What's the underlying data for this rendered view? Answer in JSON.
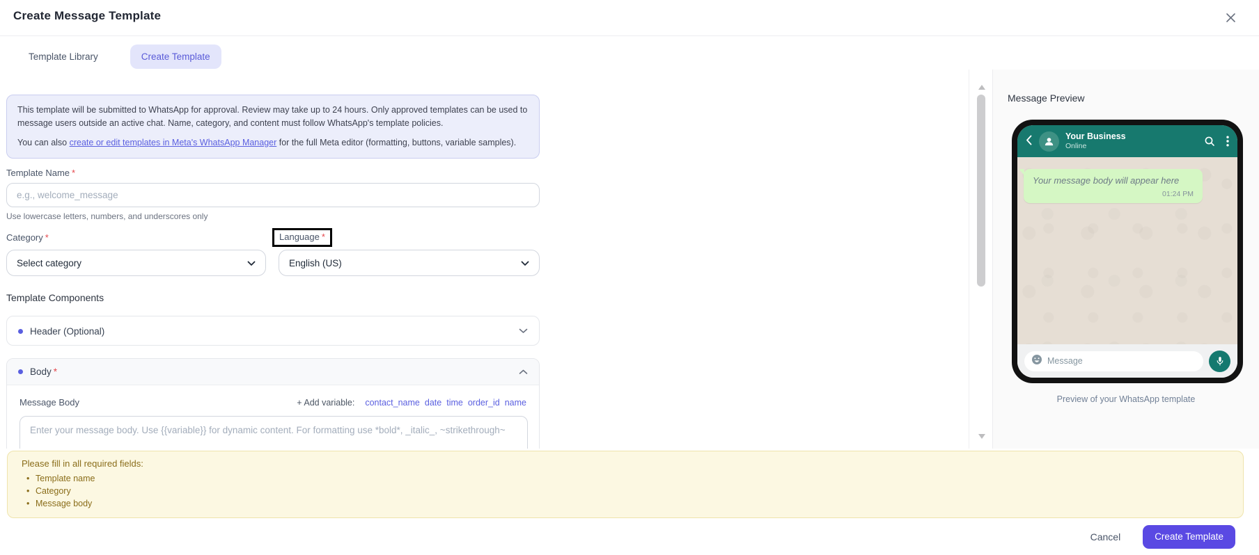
{
  "dialog": {
    "title": "Create Message Template"
  },
  "tabs": [
    {
      "label": "Template Library",
      "active": false
    },
    {
      "label": "Create Template",
      "active": true
    }
  ],
  "banner": {
    "line1": "This template will be submitted to WhatsApp for approval. Review may take up to 24 hours. Only approved templates can be used to message users outside an active chat. Name, category, and content must follow WhatsApp's template policies.",
    "line2_prefix": "You can also ",
    "line2_link": "create or edit templates in Meta's WhatsApp Manager",
    "line2_suffix": " for the full Meta editor (formatting, buttons, variable samples)."
  },
  "fields": {
    "template_name": {
      "label": "Template Name",
      "required": "*",
      "placeholder": "e.g., welcome_message",
      "helper": "Use lowercase letters, numbers, and underscores only"
    },
    "category": {
      "label": "Category",
      "required": "*",
      "value": "Select category"
    },
    "language": {
      "label": "Language",
      "required": "*",
      "value": "English (US)"
    }
  },
  "components": {
    "heading": "Template Components",
    "header_section": {
      "label": "Header (Optional)"
    },
    "body_section": {
      "label": "Body",
      "required": "*"
    },
    "message_body": {
      "label": "Message Body",
      "add_variable_label": "+ Add variable:",
      "variables": [
        "contact_name",
        "date",
        "time",
        "order_id",
        "name"
      ],
      "placeholder": "Enter your message body. Use {{variable}} for dynamic content. For formatting use *bold*, _italic_, ~strikethrough~"
    }
  },
  "validation": {
    "title": "Please fill in all required fields:",
    "items": [
      "Template name",
      "Category",
      "Message body"
    ]
  },
  "footer": {
    "cancel": "Cancel",
    "submit": "Create Template"
  },
  "preview": {
    "heading": "Message Preview",
    "business_name": "Your Business",
    "status": "Online",
    "bubble_text": "Your message body will appear here",
    "bubble_time": "01:24 PM",
    "input_placeholder": "Message",
    "caption": "Preview of your WhatsApp template"
  },
  "colors": {
    "accent": "#5A49E3",
    "tab_active_bg": "#E3E5FB",
    "banner_bg": "#ECEEFB",
    "link": "#5A5FE0",
    "warning_bg": "#FCF8E2",
    "warning_text": "#8A6D1A",
    "whatsapp_teal": "#17796E",
    "bubble_green": "#D5F7C4",
    "chat_wallpaper": "#E6DED4",
    "required_red": "#E5484D"
  }
}
